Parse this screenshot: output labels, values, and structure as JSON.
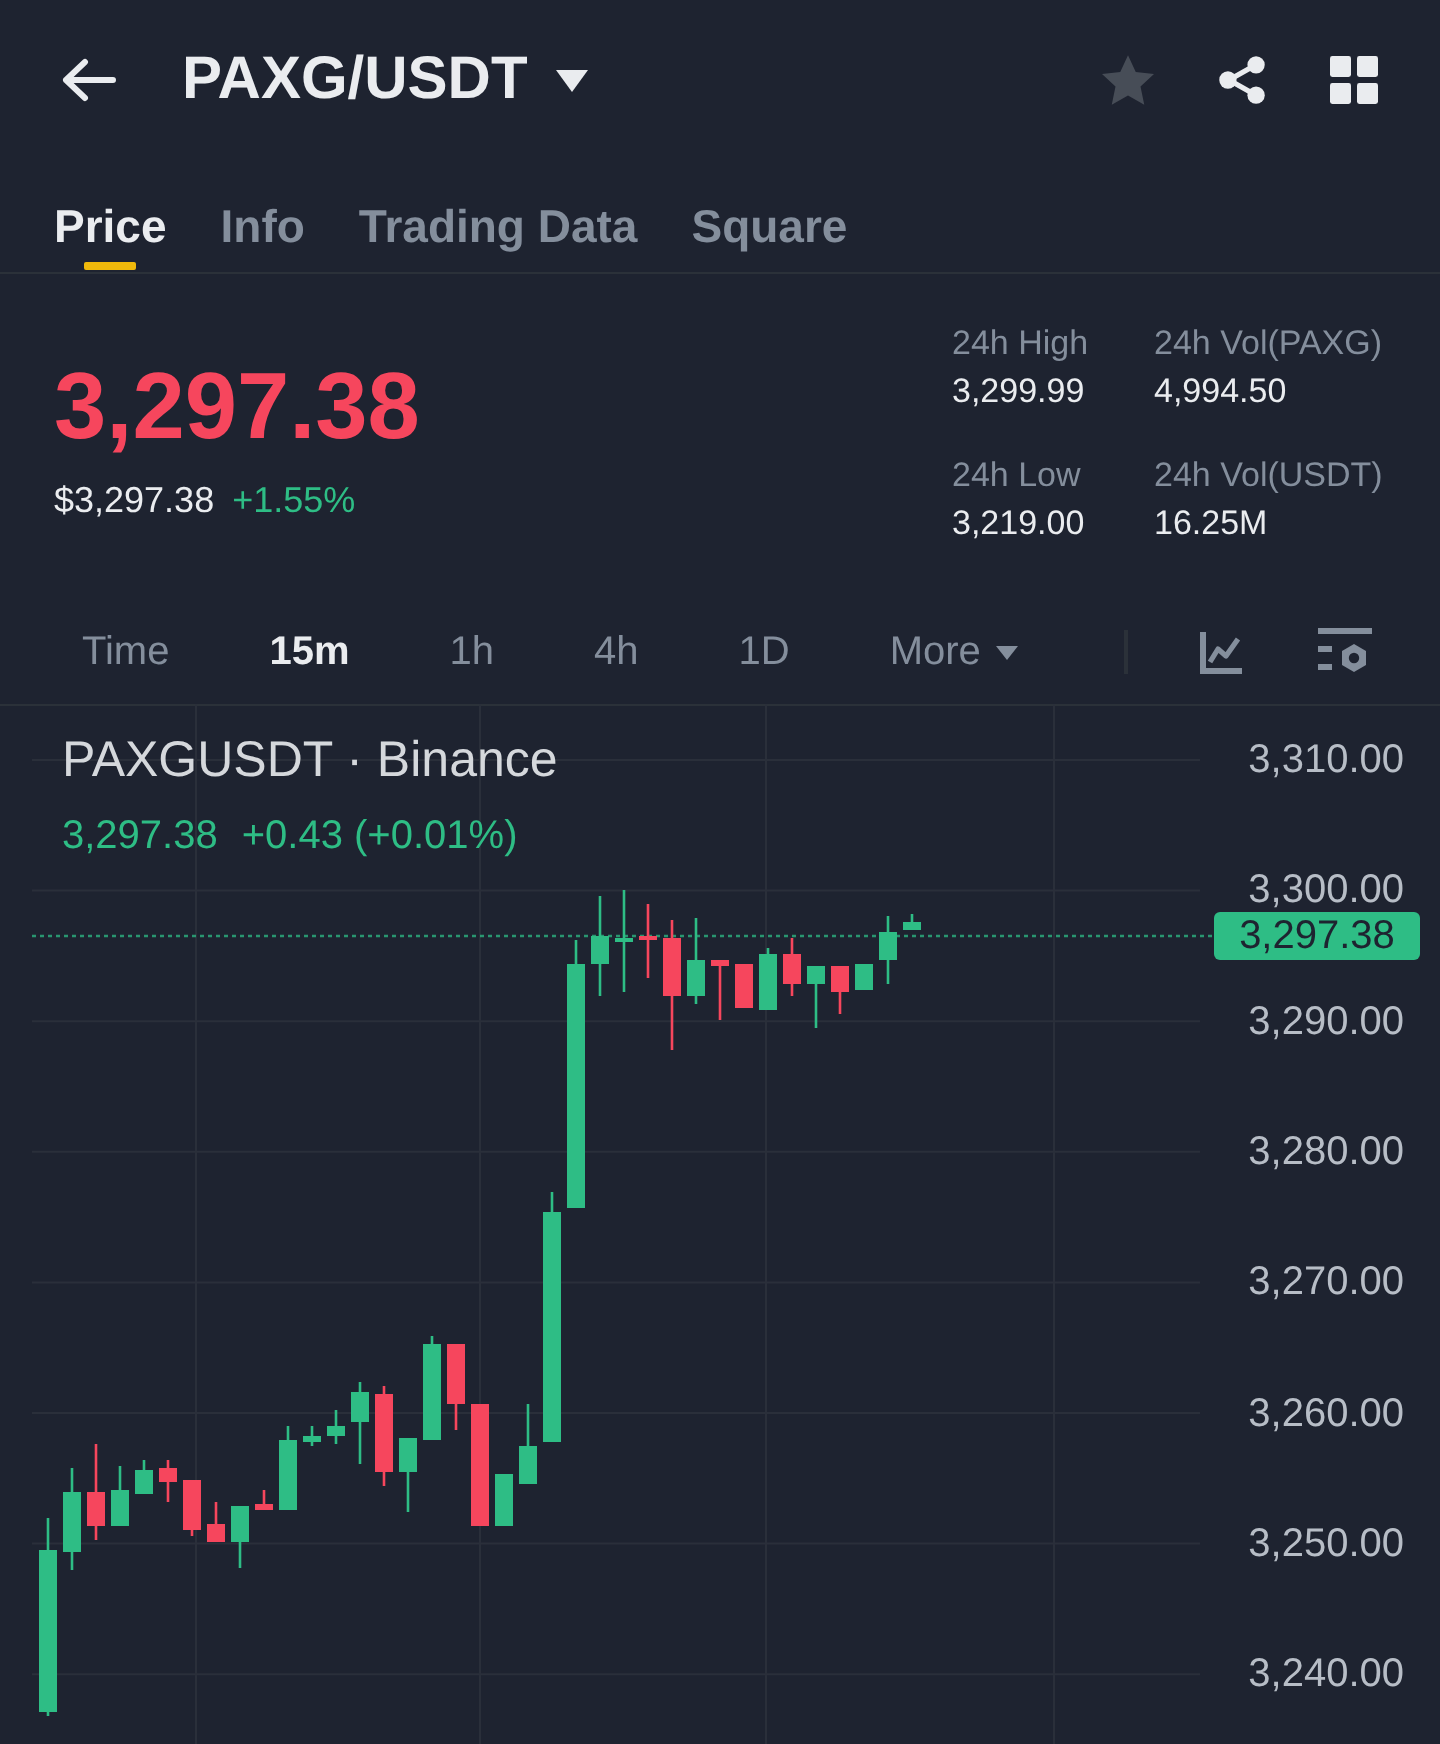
{
  "header": {
    "title": "PAXG/USDT",
    "favorite": false
  },
  "tabs": [
    {
      "label": "Price",
      "selected": true
    },
    {
      "label": "Info",
      "selected": false
    },
    {
      "label": "Trading Data",
      "selected": false
    },
    {
      "label": "Square",
      "selected": false
    }
  ],
  "ticker": {
    "last_price": "3,297.38",
    "last_price_rising": false,
    "usd_price": "$3,297.38",
    "change": "+1.55%",
    "change_rising": true,
    "stats": [
      {
        "label": "24h High",
        "value": "3,299.99"
      },
      {
        "label": "24h Vol(PAXG)",
        "value": "4,994.50"
      },
      {
        "label": "24h Low",
        "value": "3,219.00"
      },
      {
        "label": "24h Vol(USDT)",
        "value": "16.25M"
      }
    ]
  },
  "intervals": [
    {
      "label": "Time",
      "kind": "interval",
      "selected": false
    },
    {
      "label": "15m",
      "kind": "interval",
      "selected": true
    },
    {
      "label": "1h",
      "kind": "interval",
      "selected": false
    },
    {
      "label": "4h",
      "kind": "interval",
      "selected": false
    },
    {
      "label": "1D",
      "kind": "interval",
      "selected": false
    },
    {
      "label": "More",
      "kind": "menu",
      "selected": false
    }
  ],
  "chart": {
    "symbol": "PAXGUSDT · Binance",
    "last_price": "3,297.38",
    "change": "+0.43 (+0.01%)",
    "rising": true,
    "axis_labels": [
      "3,310.00",
      "3,300.00",
      "3,290.00",
      "3,280.00",
      "3,270.00",
      "3,260.00",
      "3,250.00",
      "3,240.00"
    ],
    "price_tag": "3,297.38"
  }
}
